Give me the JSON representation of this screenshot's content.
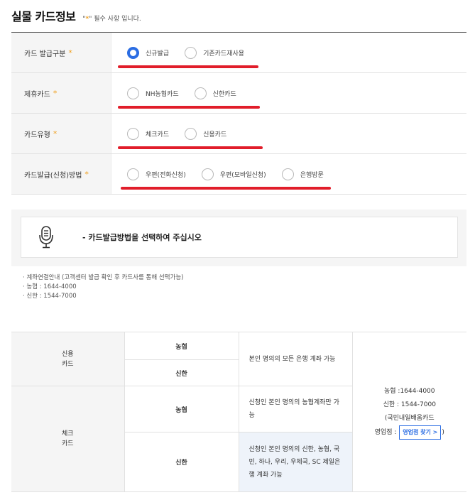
{
  "header": {
    "title": "실물 카드정보",
    "req_note_prefix": "\"",
    "req_star": "*",
    "req_note_suffix": "\" 필수 사항 입니다."
  },
  "form": {
    "rows": [
      {
        "label": "카드 발급구분",
        "options": [
          {
            "label": "신규발급",
            "checked": true
          },
          {
            "label": "기존카드재사용",
            "checked": false
          }
        ]
      },
      {
        "label": "제휴카드",
        "options": [
          {
            "label": "NH농협카드",
            "checked": false
          },
          {
            "label": "신한카드",
            "checked": false
          }
        ]
      },
      {
        "label": "카드유형",
        "options": [
          {
            "label": "체크카드",
            "checked": false
          },
          {
            "label": "신용카드",
            "checked": false
          }
        ]
      },
      {
        "label": "카드발급(신청)방법",
        "options": [
          {
            "label": "우편(전화신청)",
            "checked": false
          },
          {
            "label": "우편(모바일신청)",
            "checked": false
          },
          {
            "label": "은행방문",
            "checked": false
          }
        ]
      }
    ],
    "star": "*"
  },
  "notice": {
    "message": "- 카드발급방법을 선택하여 주십시오"
  },
  "info": {
    "lines": [
      "· 계좌연결안내 (고객센터 발급 확인 후 카드사를 통해 선택가능)",
      "· 농협 : 1644-4000",
      "· 신한 : 1544-7000"
    ]
  },
  "table": {
    "credit_label_1": "신용",
    "credit_label_2": "카드",
    "check_label_1": "체크",
    "check_label_2": "카드",
    "nh": "농협",
    "sh": "신한",
    "credit_desc": "본인 명의의 모든 은행 계좌 가능",
    "check_nh_desc": "신청인 본인 명의의 농협계좌만 가능",
    "check_sh_desc": "신청인 본인 명의의 신한, 농협, 국민, 하나, 우리, 우체국, SC 제일은행 계좌 가능",
    "contact_nh": "농협 :1644-4000",
    "contact_sh": "신한 : 1544-7000",
    "contact_note": "(국민내일배움카드",
    "branch_prefix": "영업점 :",
    "branch_button": "영업점 찾기 >",
    "branch_suffix": ")"
  },
  "colors": {
    "accent": "#2b6de3",
    "star": "#f0a020",
    "underline": "#e11d2a"
  }
}
